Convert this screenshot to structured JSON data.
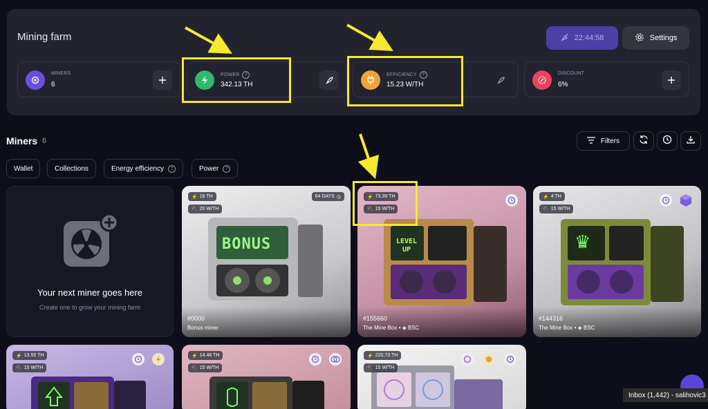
{
  "farm": {
    "title": "Mining farm",
    "timer": "22:44:58",
    "settings_label": "Settings",
    "stats": [
      {
        "label": "MINERS",
        "value": "6",
        "icon": "cpu-icon",
        "color": "#6a4fdc",
        "action": "plus-icon"
      },
      {
        "label": "POWER",
        "value": "342.13 TH",
        "icon": "bolt-icon",
        "color": "#2eb872",
        "action": "rocket-icon"
      },
      {
        "label": "EFFICIENCY",
        "value": "15.23 W/TH",
        "icon": "plug-icon",
        "color": "#f2a23a",
        "action": "rocket-icon"
      },
      {
        "label": "DISCOUNT",
        "value": "6%",
        "icon": "percent-badge-icon",
        "color": "#e8435a",
        "action": "plus-icon"
      }
    ]
  },
  "miners": {
    "title": "Miners",
    "count": "6",
    "filters_label": "Filters",
    "chips": [
      "Wallet",
      "Collections",
      "Energy efficiency",
      "Power"
    ]
  },
  "empty_card": {
    "title": "Your next miner goes here",
    "subtitle": "Create one to grow your mining farm"
  },
  "cards": [
    {
      "power": "16 TH",
      "eff": "20 W/TH",
      "days": "64 DAYS",
      "id": "#0000",
      "name": "Bonus miner",
      "screen": "BONUS",
      "bg": "#d6d6d8"
    },
    {
      "power": "73.39 TH",
      "eff": "15 W/TH",
      "id": "#155660",
      "name": "The Mine Box • ◈ BSC",
      "screen": "LEVEL UP",
      "bg": "#c99aad"
    },
    {
      "power": "4 TH",
      "eff": "15 W/TH",
      "id": "#144316",
      "name": "The Mine Box • ◈ BSC",
      "screen": "♛",
      "bg": "#c9c9cb"
    },
    {
      "power": "13.55 TH",
      "eff": "15 W/TH",
      "bg": "#a999cc"
    },
    {
      "power": "14.46 TH",
      "eff": "15 W/TH",
      "bg": "#cc9aa6"
    },
    {
      "power": "220.73 TH",
      "eff": "15 W/TH",
      "bg": "#ebebeb"
    }
  ],
  "tooltip": "Inbox (1,442) - salihovic3"
}
